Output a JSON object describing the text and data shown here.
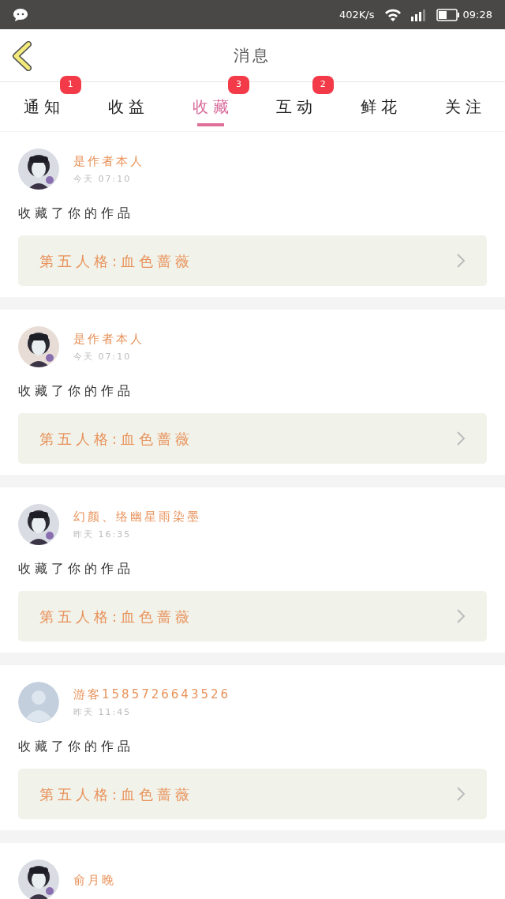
{
  "status_bar": {
    "speed": "402K/s",
    "time": "09:28"
  },
  "header": {
    "title": "消息"
  },
  "tabs": [
    {
      "label": "通知",
      "selected": false,
      "badge": "1"
    },
    {
      "label": "收益",
      "selected": false
    },
    {
      "label": "收藏",
      "selected": true,
      "badge": "3"
    },
    {
      "label": "互动",
      "selected": false,
      "badge": "2"
    },
    {
      "label": "鲜花",
      "selected": false
    },
    {
      "label": "关注",
      "selected": false
    }
  ],
  "messages": [
    {
      "user": "是作者本人",
      "time": "今天 07:10",
      "action": "收藏了你的作品",
      "work": "第五人格:血色蔷薇"
    },
    {
      "user": "是作者本人",
      "time": "今天 07:10",
      "action": "收藏了你的作品",
      "work": "第五人格:血色蔷薇"
    },
    {
      "user": "幻颜、络幽星雨染墨",
      "time": "昨天 16:35",
      "action": "收藏了你的作品",
      "work": "第五人格:血色蔷薇"
    },
    {
      "user": "游客1585726643526",
      "avatar": {
        "kind": "default"
      },
      "time": "昨天 11:45",
      "action": "收藏了你的作品",
      "work": "第五人格:血色蔷薇"
    },
    {
      "user": "俞月晚"
    }
  ]
}
